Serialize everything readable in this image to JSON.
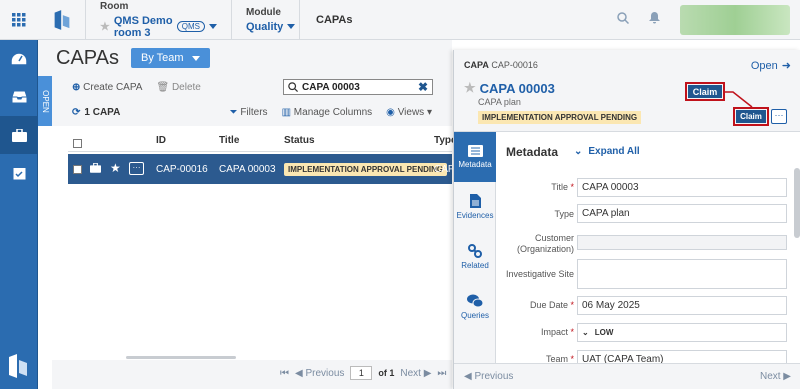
{
  "topbar": {
    "room_label": "Room",
    "room_value": "QMS Demo room 3",
    "room_tag": "QMS",
    "module_label": "Module",
    "module_value": "Quality",
    "current": "CAPAs"
  },
  "header": {
    "title": "CAPAs",
    "team_button": "By Team"
  },
  "open_tab": "OPEN",
  "toolbar": {
    "create": "Create CAPA",
    "delete": "Delete"
  },
  "search": {
    "value": "CAPA 00003"
  },
  "list": {
    "count": "1 CAPA",
    "filters": "Filters",
    "manage_columns": "Manage Columns",
    "views": "Views"
  },
  "table": {
    "columns": [
      "ID",
      "Title",
      "Status",
      "Type"
    ],
    "rows": [
      {
        "id": "CAP-00016",
        "title": "CAPA 00003",
        "status": "IMPLEMENTATION APPROVAL PENDING",
        "type": "CAPA"
      }
    ]
  },
  "pager": {
    "previous": "Previous",
    "page": "1",
    "of": "of 1",
    "next": "Next"
  },
  "panel": {
    "kind": "CAPA",
    "code": "CAP-00016",
    "open_label": "Open",
    "title": "CAPA 00003",
    "subtitle": "CAPA plan",
    "status": "IMPLEMENTATION APPROVAL PENDING",
    "claim_primary": "Claim",
    "claim_secondary": "Claim",
    "more": "···",
    "tabs": [
      "Metadata",
      "Evidences",
      "Related",
      "Queries"
    ],
    "section_title": "Metadata",
    "expand_all": "Expand All",
    "fields": [
      {
        "label": "Title",
        "required": true,
        "value": "CAPA 00003"
      },
      {
        "label": "Type",
        "required": false,
        "value": "CAPA plan"
      },
      {
        "label": "Customer (Organization)",
        "required": false,
        "value": ""
      },
      {
        "label": "Investigative Site",
        "required": false,
        "value": ""
      },
      {
        "label": "Due Date",
        "required": true,
        "value": "06 May 2025"
      },
      {
        "label": "Impact",
        "required": true,
        "value": "LOW"
      },
      {
        "label": "Team",
        "required": true,
        "value": "UAT (CAPA Team)"
      }
    ],
    "prev": "Previous",
    "next": "Next"
  },
  "colors": {
    "primary": "#2b6cb0",
    "highlight": "#c0121b",
    "pending": "#fbe7b2"
  }
}
